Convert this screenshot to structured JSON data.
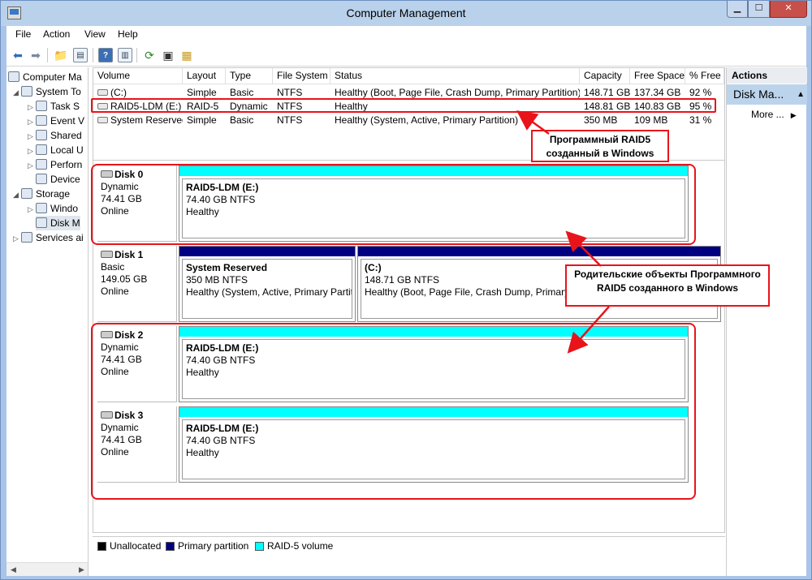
{
  "window": {
    "title": "Computer Management"
  },
  "menu": [
    "File",
    "Action",
    "View",
    "Help"
  ],
  "tree": [
    {
      "label": "Computer Ma",
      "icon": "computer-icon",
      "expander": ""
    },
    {
      "label": "System To",
      "icon": "tools-icon",
      "expander": "◢"
    },
    {
      "label": "Task S",
      "icon": "clock-icon",
      "expander": "▷"
    },
    {
      "label": "Event V",
      "icon": "event-viewer-icon",
      "expander": "▷"
    },
    {
      "label": "Shared",
      "icon": "shared-folder-icon",
      "expander": "▷"
    },
    {
      "label": "Local U",
      "icon": "users-icon",
      "expander": "▷"
    },
    {
      "label": "Perforn",
      "icon": "performance-icon",
      "expander": "▷"
    },
    {
      "label": "Device",
      "icon": "device-manager-icon",
      "expander": ""
    },
    {
      "label": "Storage",
      "icon": "storage-icon",
      "expander": "◢"
    },
    {
      "label": "Windo",
      "icon": "backup-icon",
      "expander": "▷"
    },
    {
      "label": "Disk M",
      "icon": "disk-management-icon",
      "expander": ""
    },
    {
      "label": "Services ai",
      "icon": "services-icon",
      "expander": "▷"
    }
  ],
  "volumes": {
    "headers": [
      "Volume",
      "Layout",
      "Type",
      "File System",
      "Status",
      "Capacity",
      "Free Space",
      "% Free"
    ],
    "rows": [
      [
        "(C:)",
        "Simple",
        "Basic",
        "NTFS",
        "Healthy (Boot, Page File, Crash Dump, Primary Partition)",
        "148.71 GB",
        "137.34 GB",
        "92 %"
      ],
      [
        "RAID5-LDM (E:)",
        "RAID-5",
        "Dynamic",
        "NTFS",
        "Healthy",
        "148.81 GB",
        "140.83 GB",
        "95 %"
      ],
      [
        "System Reserved",
        "Simple",
        "Basic",
        "NTFS",
        "Healthy (System, Active, Primary Partition)",
        "350 MB",
        "109 MB",
        "31 %"
      ]
    ]
  },
  "disks": [
    {
      "name": "Disk 0",
      "type": "Dynamic",
      "size": "74.41 GB",
      "state": "Online",
      "partitions": [
        {
          "name": "RAID5-LDM  (E:)",
          "size": "74.40 GB NTFS",
          "status": "Healthy",
          "kind": "raid"
        }
      ]
    },
    {
      "name": "Disk 1",
      "type": "Basic",
      "size": "149.05 GB",
      "state": "Online",
      "partitions": [
        {
          "name": "System Reserved",
          "size": "350 MB NTFS",
          "status": "Healthy (System, Active, Primary Partit",
          "kind": "prim"
        },
        {
          "name": "(C:)",
          "size": "148.71 GB NTFS",
          "status": "Healthy (Boot, Page File, Crash Dump, Primary",
          "kind": "prim"
        }
      ]
    },
    {
      "name": "Disk 2",
      "type": "Dynamic",
      "size": "74.41 GB",
      "state": "Online",
      "partitions": [
        {
          "name": "RAID5-LDM  (E:)",
          "size": "74.40 GB NTFS",
          "status": "Healthy",
          "kind": "raid"
        }
      ]
    },
    {
      "name": "Disk 3",
      "type": "Dynamic",
      "size": "74.41 GB",
      "state": "Online",
      "partitions": [
        {
          "name": "RAID5-LDM  (E:)",
          "size": "74.40 GB NTFS",
          "status": "Healthy",
          "kind": "raid"
        }
      ]
    }
  ],
  "legend": [
    {
      "label": "Unallocated",
      "color": "#000000"
    },
    {
      "label": "Primary partition",
      "color": "#000080"
    },
    {
      "label": "RAID-5 volume",
      "color": "#00ffff"
    }
  ],
  "actions": {
    "header": "Actions",
    "section": "Disk Ma...",
    "more": "More ..."
  },
  "annotations": {
    "callout1": "Программный RAID5 созданный в Windows",
    "callout2": "Родительские объекты Программного RAID5 созданного в Windows",
    "color": "#e8141a"
  }
}
